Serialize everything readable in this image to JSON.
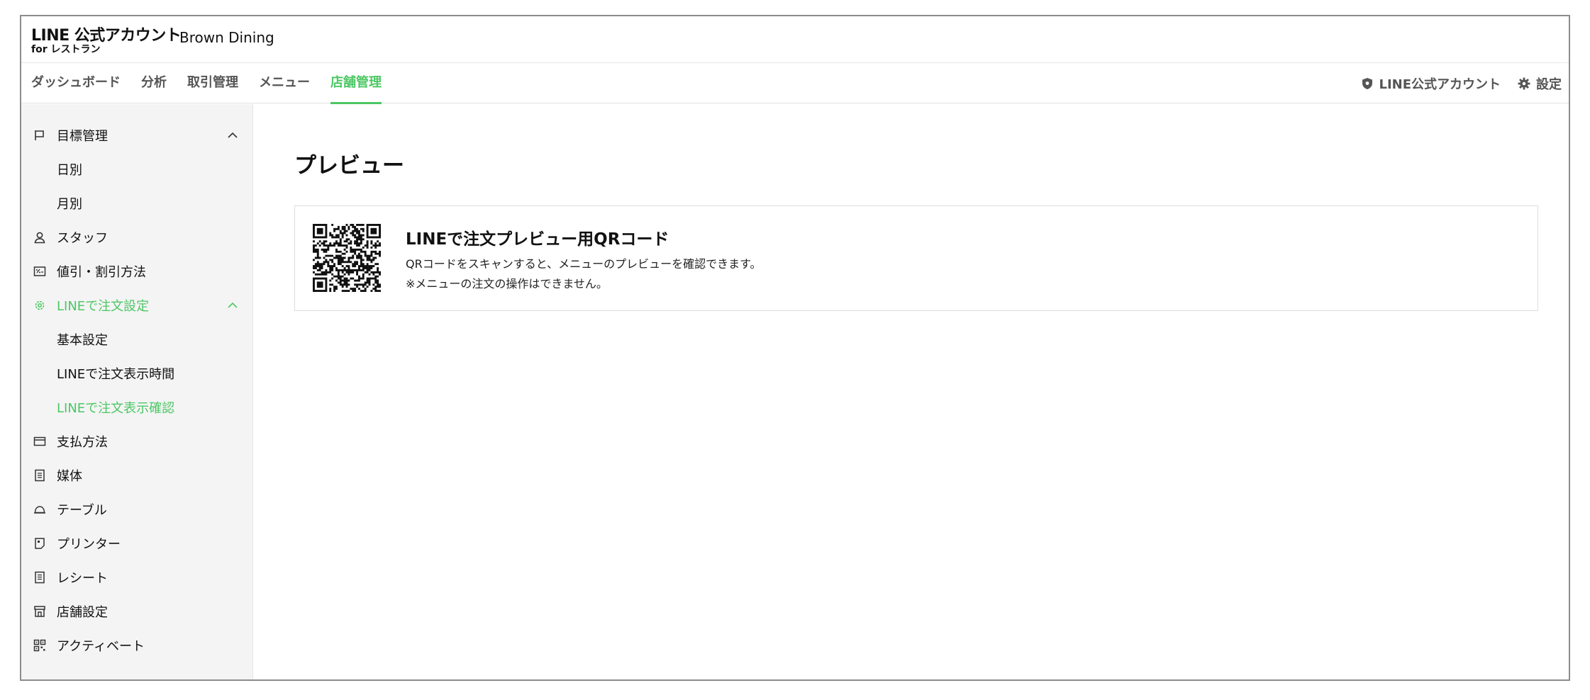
{
  "header": {
    "logo_main": "LINE 公式アカウント",
    "logo_sub": "for レストラン",
    "account_name": "Brown Dining"
  },
  "nav": {
    "tabs": [
      {
        "label": "ダッシュボード",
        "active": false
      },
      {
        "label": "分析",
        "active": false
      },
      {
        "label": "取引管理",
        "active": false
      },
      {
        "label": "メニュー",
        "active": false
      },
      {
        "label": "店舗管理",
        "active": true
      }
    ],
    "right": {
      "official_account": "LINE公式アカウント",
      "settings": "設定"
    }
  },
  "sidebar": {
    "items": [
      {
        "label": "目標管理",
        "icon": "flag-icon",
        "expanded": true
      },
      {
        "label": "日別",
        "sub": true
      },
      {
        "label": "月別",
        "sub": true
      },
      {
        "label": "スタッフ",
        "icon": "person-icon"
      },
      {
        "label": "値引・割引方法",
        "icon": "discount-icon"
      },
      {
        "label": "LINEで注文設定",
        "icon": "gear-icon",
        "expanded": true,
        "active": true
      },
      {
        "label": "基本設定",
        "sub": true
      },
      {
        "label": "LINEで注文表示時間",
        "sub": true
      },
      {
        "label": "LINEで注文表示確認",
        "sub": true,
        "active": true
      },
      {
        "label": "支払方法",
        "icon": "wallet-icon"
      },
      {
        "label": "媒体",
        "icon": "document-icon"
      },
      {
        "label": "テーブル",
        "icon": "cloche-icon"
      },
      {
        "label": "プリンター",
        "icon": "printer-icon"
      },
      {
        "label": "レシート",
        "icon": "receipt-icon"
      },
      {
        "label": "店舗設定",
        "icon": "store-icon"
      },
      {
        "label": "アクティベート",
        "icon": "qr-icon"
      }
    ]
  },
  "main": {
    "title": "プレビュー",
    "card": {
      "title": "LINEで注文プレビュー用QRコード",
      "desc_line1": "QRコードをスキャンすると、メニューのプレビューを確認できます。",
      "desc_line2": "※メニューの注文の操作はできません。"
    }
  },
  "colors": {
    "accent": "#4cc764",
    "sidebar_bg": "#f4f4f4",
    "border": "#dedede",
    "text": "#111111",
    "muted": "#555555"
  }
}
